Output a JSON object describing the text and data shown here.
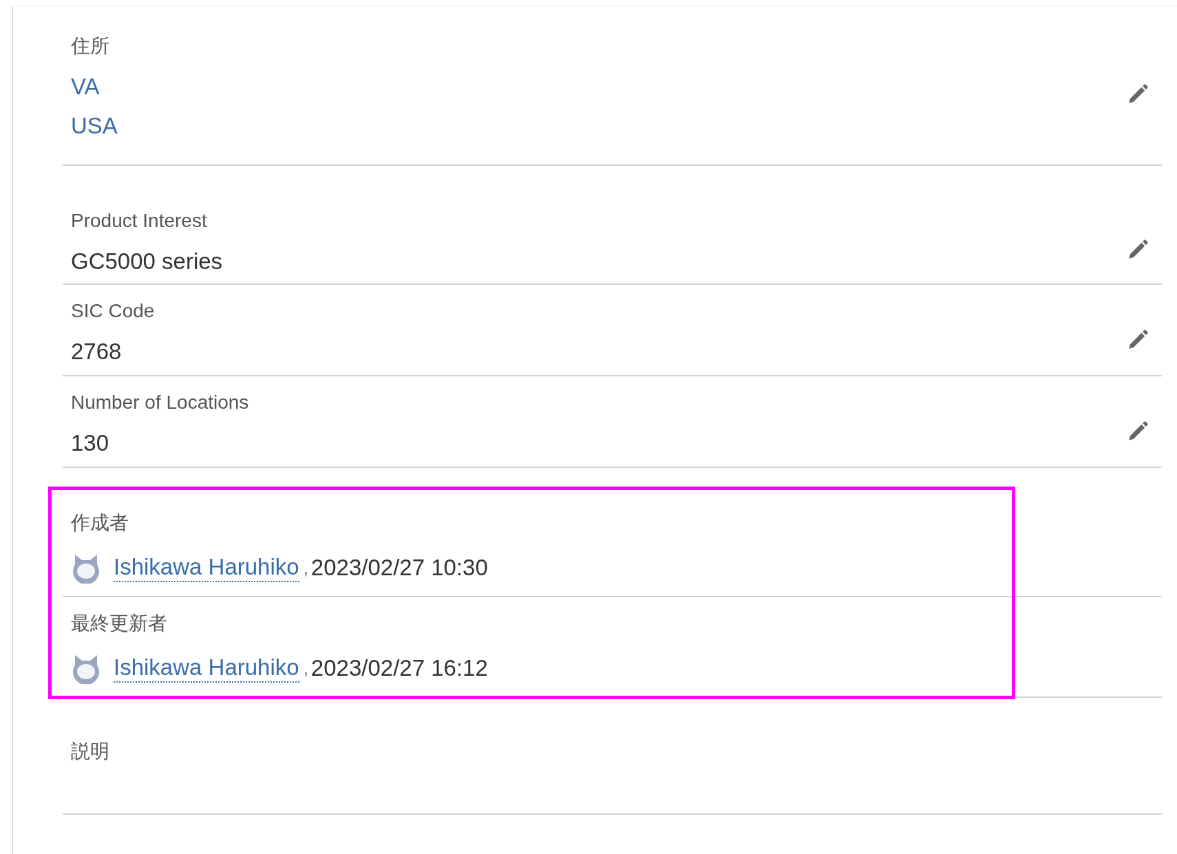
{
  "fields": [
    {
      "kind": "lines",
      "label": "住所",
      "values": [
        "VA",
        "USA"
      ],
      "editable": true
    },
    {
      "kind": "text",
      "label": "Product Interest",
      "value": "GC5000 series",
      "editable": true
    },
    {
      "kind": "text",
      "label": "SIC Code",
      "value": "2768",
      "editable": true
    },
    {
      "kind": "text",
      "label": "Number of Locations",
      "value": "130",
      "editable": true
    }
  ],
  "audit": {
    "highlighted": true,
    "entries": [
      {
        "label": "作成者",
        "user": "Ishikawa Haruhiko",
        "separator": ",",
        "timestamp": "2023/02/27 10:30"
      },
      {
        "label": "最終更新者",
        "user": "Ishikawa Haruhiko",
        "separator": ",",
        "timestamp": "2023/02/27 16:12"
      }
    ]
  },
  "description": {
    "label": "説明"
  }
}
